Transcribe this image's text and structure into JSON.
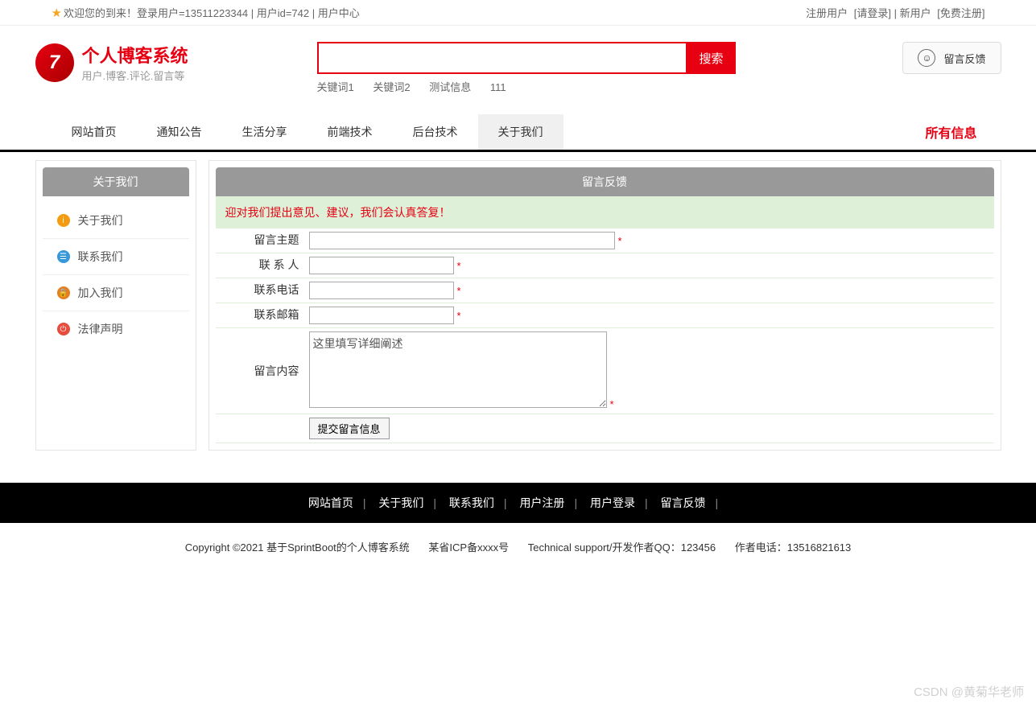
{
  "topbar": {
    "welcome": "欢迎您的到来！登录用户=13511223344 | 用户id=742 | 用户中心",
    "reg_label": "注册用户",
    "login": "[请登录]",
    "new_label": "新用户",
    "reg": "[免费注册]"
  },
  "logo": {
    "title": "个人博客系统",
    "sub": "用户.博客.评论.留言等"
  },
  "search": {
    "btn": "搜索",
    "keywords": [
      "关键词1",
      "关键词2",
      "测试信息",
      "111"
    ]
  },
  "feedback_btn": "留言反馈",
  "nav": {
    "items": [
      "网站首页",
      "通知公告",
      "生活分享",
      "前端技术",
      "后台技术",
      "关于我们"
    ],
    "right": "所有信息"
  },
  "sidebar": {
    "title": "关于我们",
    "items": [
      {
        "label": "关于我们",
        "icon": "ico-orange",
        "glyph": "i"
      },
      {
        "label": "联系我们",
        "icon": "ico-blue",
        "glyph": "☰"
      },
      {
        "label": "加入我们",
        "icon": "ico-orange2",
        "glyph": "🔒"
      },
      {
        "label": "法律声明",
        "icon": "ico-red",
        "glyph": "⏻"
      }
    ]
  },
  "panel": {
    "title": "留言反馈",
    "notice": "迎对我们提出意见、建议，我们会认真答复！"
  },
  "form": {
    "subject": "留言主题",
    "contact": "联 系 人",
    "phone": "联系电话",
    "email": "联系邮箱",
    "content": "留言内容",
    "placeholder": "这里填写详细阐述",
    "submit": "提交留言信息",
    "star": "*"
  },
  "footer": {
    "links": [
      "网站首页",
      "关于我们",
      "联系我们",
      "用户注册",
      "用户登录",
      "留言反馈"
    ],
    "copy1": "Copyright ©2021 基于SprintBoot的个人博客系统",
    "copy2": "某省ICP备xxxx号",
    "copy3": "Technical support/开发作者QQ：123456",
    "copy4": "作者电话：13516821613"
  },
  "watermark": "CSDN @黄菊华老师"
}
